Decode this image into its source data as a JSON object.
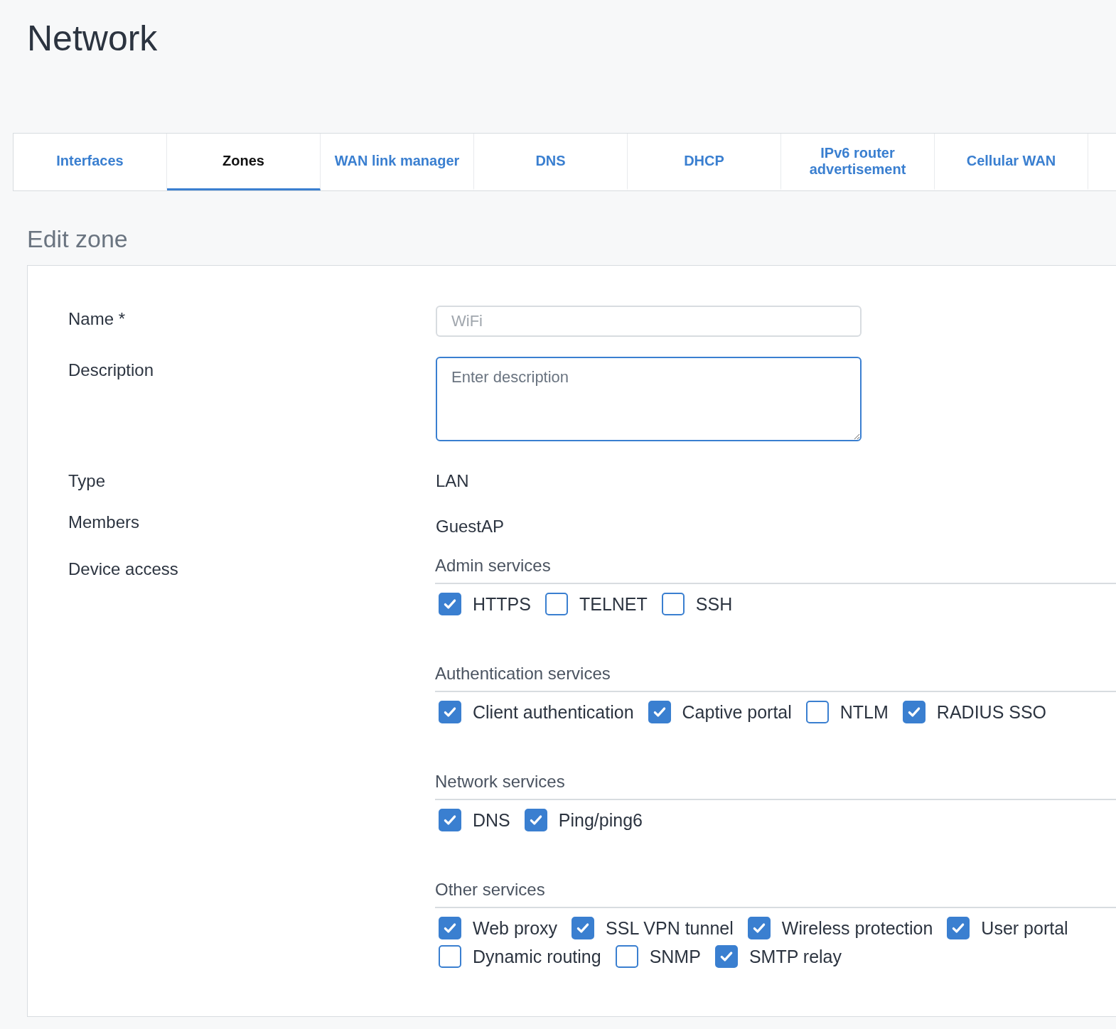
{
  "title": "Network",
  "tabs": [
    {
      "label": "Interfaces",
      "selected": false
    },
    {
      "label": "Zones",
      "selected": true
    },
    {
      "label": "WAN link manager",
      "selected": false
    },
    {
      "label": "DNS",
      "selected": false
    },
    {
      "label": "DHCP",
      "selected": false
    },
    {
      "label": "IPv6 router advertisement",
      "selected": false
    },
    {
      "label": "Cellular WAN",
      "selected": false
    }
  ],
  "section_title": "Edit zone",
  "form": {
    "name": {
      "label": "Name *",
      "value": "WiFi",
      "disabled": true
    },
    "description": {
      "label": "Description",
      "placeholder": "Enter description"
    },
    "type": {
      "label": "Type",
      "value": "LAN"
    },
    "members": {
      "label": "Members",
      "value": "GuestAP"
    },
    "device_access": {
      "label": "Device access",
      "groups": [
        {
          "title": "Admin services",
          "services": [
            {
              "label": "HTTPS",
              "checked": true
            },
            {
              "label": "TELNET",
              "checked": false
            },
            {
              "label": "SSH",
              "checked": false
            }
          ]
        },
        {
          "title": "Authentication services",
          "services": [
            {
              "label": "Client authentication",
              "checked": true
            },
            {
              "label": "Captive portal",
              "checked": true
            },
            {
              "label": "NTLM",
              "checked": false
            },
            {
              "label": "RADIUS SSO",
              "checked": true
            }
          ]
        },
        {
          "title": "Network services",
          "services": [
            {
              "label": "DNS",
              "checked": true
            },
            {
              "label": "Ping/ping6",
              "checked": true
            }
          ]
        },
        {
          "title": "Other services",
          "services": [
            {
              "label": "Web proxy",
              "checked": true
            },
            {
              "label": "SSL VPN tunnel",
              "checked": true
            },
            {
              "label": "Wireless protection",
              "checked": true
            },
            {
              "label": "User portal",
              "checked": true
            },
            {
              "label": "Dynamic routing",
              "checked": false
            },
            {
              "label": "SNMP",
              "checked": false
            },
            {
              "label": "SMTP relay",
              "checked": true
            }
          ]
        }
      ]
    }
  }
}
